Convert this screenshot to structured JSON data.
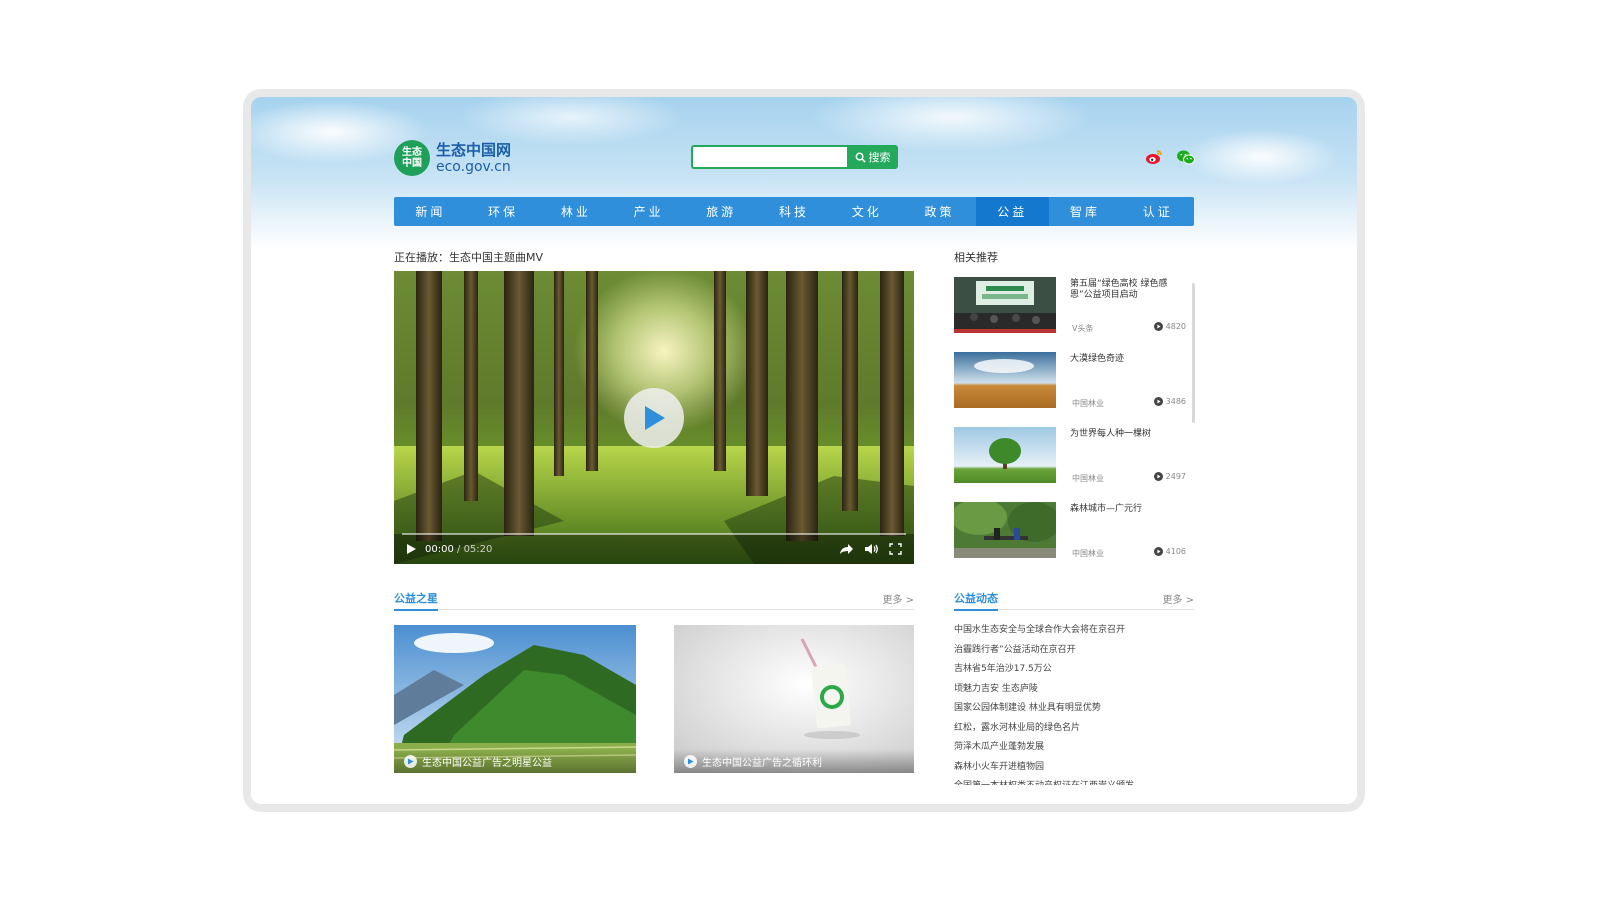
{
  "header": {
    "logo_badge": "生态\n中国",
    "logo_cn": "生态中国网",
    "logo_en": "eco.gov.cn",
    "search_placeholder": "",
    "search_label": "搜索",
    "social_icons": [
      "weibo-icon",
      "wechat-icon"
    ]
  },
  "nav": {
    "items": [
      "新闻",
      "环保",
      "林业",
      "产业",
      "旅游",
      "科技",
      "文化",
      "政策",
      "公益",
      "智库",
      "认证"
    ],
    "active_index": 8
  },
  "player": {
    "now_playing": "正在播放：生态中国主题曲MV",
    "time_current": "00:00",
    "time_total": "/ 05:20"
  },
  "related": {
    "title": "相关推荐",
    "items": [
      {
        "title": "第五届“绿色高校 绿色感恩”公益项目启动",
        "source": "V头条",
        "views": "4820"
      },
      {
        "title": "大漠绿色奇迹",
        "source": "中国林业",
        "views": "3486"
      },
      {
        "title": "为世界每人种一棵树",
        "source": "中国林业",
        "views": "2497"
      },
      {
        "title": "森林城市—广元行",
        "source": "中国林业",
        "views": "4106"
      }
    ]
  },
  "stars": {
    "title": "公益之星",
    "more": "更多 >",
    "cards": [
      {
        "caption": "生态中国公益广告之明星公益"
      },
      {
        "caption": "生态中国公益广告之循环利"
      }
    ]
  },
  "news": {
    "title": "公益动态",
    "more": "更多 >",
    "items": [
      "中国水生态安全与全球合作大会将在京召开",
      "治霾践行者”公益活动在京召开",
      "吉林省5年治沙17.5万公",
      "顷魅力吉安 生态庐陵",
      "国家公园体制建设 林业具有明显优势",
      "红松，露水河林业局的绿色名片",
      "菏泽木瓜产业蓬勃发展",
      "森林小火车开进植物园",
      "全国第一本林权类不动产权证在江西崇义颁发"
    ]
  },
  "colors": {
    "nav_bg": "#2f8fdb",
    "nav_active": "#1478cf",
    "search_green": "#23a85c",
    "section_blue": "#2f8fdb"
  }
}
